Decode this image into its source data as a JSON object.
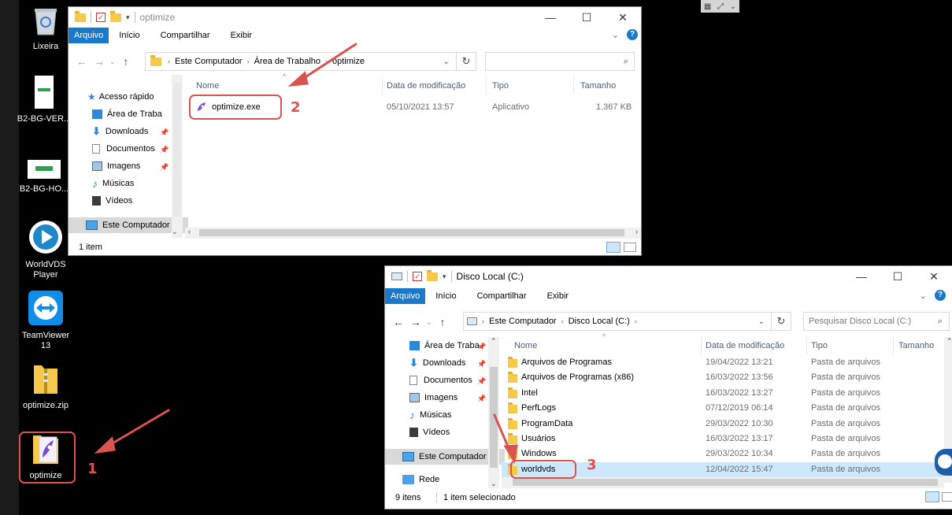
{
  "desktop": {
    "icons": [
      {
        "label": "Lixeira",
        "icon": "recycle-bin-icon"
      },
      {
        "label": "B2-BG-VER...",
        "icon": "document-icon"
      },
      {
        "label": "B2-BG-HO...",
        "icon": "document-icon"
      },
      {
        "label": "WorldVDS Player",
        "icon": "play-icon"
      },
      {
        "label": "TeamViewer 13",
        "icon": "teamviewer-icon"
      },
      {
        "label": "optimize.zip",
        "icon": "zip-folder-icon"
      },
      {
        "label": "optimize",
        "icon": "app-icon"
      }
    ],
    "top_widget_icon": "monitor-controls-icon"
  },
  "window1": {
    "title": "optimize",
    "ribbon": {
      "file": "Arquivo",
      "tabs": [
        "Início",
        "Compartilhar",
        "Exibir"
      ],
      "help": "?"
    },
    "breadcrumb": [
      "Este Computador",
      "Área de Trabalho",
      "optimize"
    ],
    "nav": [
      {
        "label": "Acesso rápido",
        "icon": "star-icon"
      },
      {
        "label": "Área de Traba",
        "icon": "desktop-icon"
      },
      {
        "label": "Downloads",
        "icon": "download-icon"
      },
      {
        "label": "Documentos",
        "icon": "documents-icon"
      },
      {
        "label": "Imagens",
        "icon": "images-icon"
      },
      {
        "label": "Músicas",
        "icon": "music-icon"
      },
      {
        "label": "Vídeos",
        "icon": "video-icon"
      },
      {
        "label": "Este Computador",
        "icon": "computer-icon"
      }
    ],
    "columns": [
      "Nome",
      "Data de modificação",
      "Tipo",
      "Tamanho"
    ],
    "files": [
      {
        "name": "optimize.exe",
        "date": "05/10/2021 13:57",
        "type": "Aplicativo",
        "size": "1.367 KB"
      }
    ],
    "status": "1 item"
  },
  "window2": {
    "title": "Disco Local (C:)",
    "ribbon": {
      "file": "Arquivo",
      "tabs": [
        "Início",
        "Compartilhar",
        "Exibir"
      ],
      "help": "?"
    },
    "breadcrumb": [
      "Este Computador",
      "Disco Local (C:)"
    ],
    "search_placeholder": "Pesquisar Disco Local (C:)",
    "nav": [
      {
        "label": "Área de Traba",
        "icon": "desktop-icon"
      },
      {
        "label": "Downloads",
        "icon": "download-icon"
      },
      {
        "label": "Documentos",
        "icon": "documents-icon"
      },
      {
        "label": "Imagens",
        "icon": "images-icon"
      },
      {
        "label": "Músicas",
        "icon": "music-icon"
      },
      {
        "label": "Vídeos",
        "icon": "video-icon"
      },
      {
        "label": "Este Computador",
        "icon": "computer-icon"
      },
      {
        "label": "Rede",
        "icon": "network-icon"
      }
    ],
    "columns": [
      "Nome",
      "Data de modificação",
      "Tipo",
      "Tamanho"
    ],
    "folders": [
      {
        "name": "Arquivos de Programas",
        "date": "19/04/2022 13:21",
        "type": "Pasta de arquivos"
      },
      {
        "name": "Arquivos de Programas (x86)",
        "date": "16/03/2022 13:56",
        "type": "Pasta de arquivos"
      },
      {
        "name": "Intel",
        "date": "16/03/2022 13:27",
        "type": "Pasta de arquivos"
      },
      {
        "name": "PerfLogs",
        "date": "07/12/2019 06:14",
        "type": "Pasta de arquivos"
      },
      {
        "name": "ProgramData",
        "date": "29/03/2022 10:30",
        "type": "Pasta de arquivos"
      },
      {
        "name": "Usuários",
        "date": "16/03/2022 13:17",
        "type": "Pasta de arquivos"
      },
      {
        "name": "Windows",
        "date": "29/03/2022 10:34",
        "type": "Pasta de arquivos"
      },
      {
        "name": "worldvds",
        "date": "12/04/2022 15:47",
        "type": "Pasta de arquivos"
      }
    ],
    "status": {
      "count": "9 itens",
      "selected": "1 item selecionado"
    }
  },
  "annotations": {
    "step1": "1",
    "step2": "2",
    "step3": "3",
    "color": "#d9534f"
  },
  "colors": {
    "accent": "#1979ca",
    "selection": "#cce8ff",
    "folder": "#f6c94a"
  }
}
